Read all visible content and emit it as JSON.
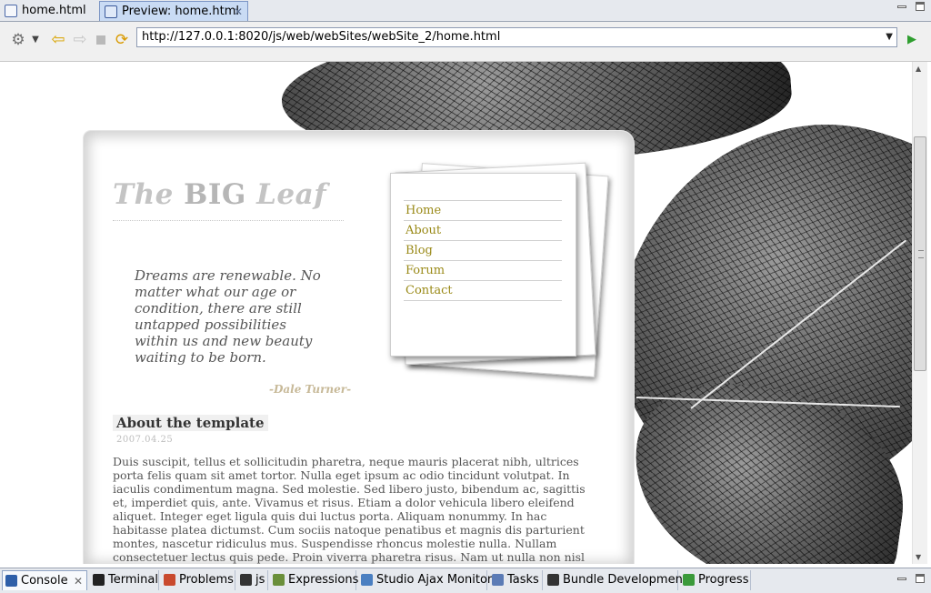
{
  "editor_tabs": [
    {
      "label": "home.html",
      "active": false
    },
    {
      "label": "Preview: home.html",
      "active": true
    }
  ],
  "toolbar": {
    "url": "http://127.0.0.1:8020/js/web/webSites/webSite_2/home.html",
    "icons": [
      "gear-icon",
      "chevron-down-icon",
      "back-arrow-icon",
      "forward-arrow-icon",
      "stop-icon",
      "refresh-icon",
      "go-icon"
    ]
  },
  "site": {
    "title_prefix": "The ",
    "title_big": "BIG",
    "title_suffix": " Leaf",
    "quote": "Dreams are renewable. No matter what our age or condition, there are still untapped possibilities within us and new beauty waiting to be born.",
    "quote_author": "-Dale Turner-",
    "nav": [
      "Home",
      "About",
      "Blog",
      "Forum",
      "Contact"
    ],
    "article": {
      "title": "About the template",
      "date": "2007.04.25",
      "body": "Duis suscipit, tellus et sollicitudin pharetra, neque mauris placerat nibh, ultrices porta felis quam sit amet tortor. Nulla eget ipsum ac odio tincidunt volutpat. In iaculis condimentum magna. Sed molestie. Sed libero justo, bibendum ac, sagittis et, imperdiet quis, ante. Vivamus et risus. Etiam a dolor vehicula libero eleifend aliquet. Integer eget ligula quis dui luctus porta. Aliquam nonummy. In hac habitasse platea dictumst. Cum sociis natoque penatibus et magnis dis parturient montes, nascetur ridiculus mus. Suspendisse rhoncus molestie nulla. Nullam consectetuer lectus quis pede. Proin viverra pharetra risus. Nam ut nulla non nisl tincidunt venenatis. Suspendisse potenti."
    }
  },
  "views": [
    {
      "label": "Console",
      "active": true
    },
    {
      "label": "Terminal",
      "active": false
    },
    {
      "label": "Problems",
      "active": false
    },
    {
      "label": "js",
      "active": false
    },
    {
      "label": "Expressions",
      "active": false
    },
    {
      "label": "Studio Ajax Monitor",
      "active": false
    },
    {
      "label": "Tasks",
      "active": false
    },
    {
      "label": "Bundle Development",
      "active": false
    },
    {
      "label": "Progress",
      "active": false
    }
  ]
}
